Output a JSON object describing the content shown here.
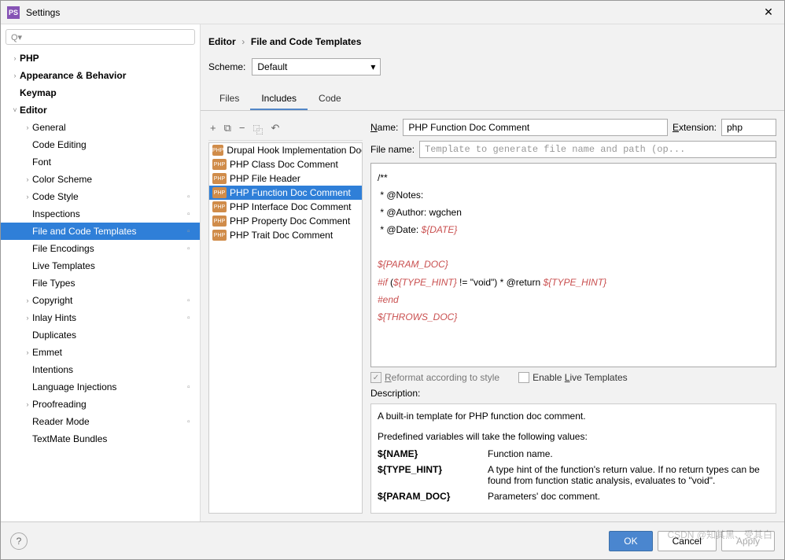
{
  "window": {
    "title": "Settings",
    "close": "✕"
  },
  "search": {
    "placeholder": ""
  },
  "tree": [
    {
      "label": "PHP",
      "bold": true,
      "chev": ">",
      "marker": "",
      "indent": 0
    },
    {
      "label": "Appearance & Behavior",
      "bold": true,
      "chev": ">",
      "marker": "",
      "indent": 0
    },
    {
      "label": "Keymap",
      "bold": true,
      "chev": "",
      "marker": "",
      "indent": 0
    },
    {
      "label": "Editor",
      "bold": true,
      "chev": "v",
      "marker": "",
      "indent": 0
    },
    {
      "label": "General",
      "bold": false,
      "chev": ">",
      "marker": "",
      "indent": 1
    },
    {
      "label": "Code Editing",
      "bold": false,
      "chev": "",
      "marker": "",
      "indent": 1
    },
    {
      "label": "Font",
      "bold": false,
      "chev": "",
      "marker": "",
      "indent": 1
    },
    {
      "label": "Color Scheme",
      "bold": false,
      "chev": ">",
      "marker": "",
      "indent": 1
    },
    {
      "label": "Code Style",
      "bold": false,
      "chev": ">",
      "marker": "■",
      "indent": 1
    },
    {
      "label": "Inspections",
      "bold": false,
      "chev": "",
      "marker": "■",
      "indent": 1
    },
    {
      "label": "File and Code Templates",
      "bold": false,
      "chev": "",
      "marker": "■",
      "indent": 1,
      "selected": true
    },
    {
      "label": "File Encodings",
      "bold": false,
      "chev": "",
      "marker": "■",
      "indent": 1
    },
    {
      "label": "Live Templates",
      "bold": false,
      "chev": "",
      "marker": "",
      "indent": 1
    },
    {
      "label": "File Types",
      "bold": false,
      "chev": "",
      "marker": "",
      "indent": 1
    },
    {
      "label": "Copyright",
      "bold": false,
      "chev": ">",
      "marker": "■",
      "indent": 1
    },
    {
      "label": "Inlay Hints",
      "bold": false,
      "chev": ">",
      "marker": "■",
      "indent": 1
    },
    {
      "label": "Duplicates",
      "bold": false,
      "chev": "",
      "marker": "",
      "indent": 1
    },
    {
      "label": "Emmet",
      "bold": false,
      "chev": ">",
      "marker": "",
      "indent": 1
    },
    {
      "label": "Intentions",
      "bold": false,
      "chev": "",
      "marker": "",
      "indent": 1
    },
    {
      "label": "Language Injections",
      "bold": false,
      "chev": "",
      "marker": "■",
      "indent": 1
    },
    {
      "label": "Proofreading",
      "bold": false,
      "chev": ">",
      "marker": "",
      "indent": 1
    },
    {
      "label": "Reader Mode",
      "bold": false,
      "chev": "",
      "marker": "■",
      "indent": 1
    },
    {
      "label": "TextMate Bundles",
      "bold": false,
      "chev": "",
      "marker": "",
      "indent": 1
    }
  ],
  "breadcrumb": {
    "a": "Editor",
    "sep": "›",
    "b": "File and Code Templates"
  },
  "scheme": {
    "label": "Scheme:",
    "value": "Default"
  },
  "tabs": [
    "Files",
    "Includes",
    "Code"
  ],
  "tabs_active": 1,
  "toolbar": {
    "add": "+",
    "copy_tpl": "⧉",
    "remove": "−",
    "copy": "⿻",
    "revert": "↶"
  },
  "templates": [
    "Drupal Hook Implementation Doc",
    "PHP Class Doc Comment",
    "PHP File Header",
    "PHP Function Doc Comment",
    "PHP Interface Doc Comment",
    "PHP Property Doc Comment",
    "PHP Trait Doc Comment"
  ],
  "templates_selected": 3,
  "fields": {
    "name_label": "Name:",
    "name_ul": "N",
    "name_value": "PHP Function Doc Comment",
    "ext_label": "Extension:",
    "ext_ul": "E",
    "ext_value": "php",
    "fname_label": "File name:",
    "fname_placeholder": "Template to generate file name and path (op..."
  },
  "code": {
    "l1": "/**",
    "l2": " * @Notes:",
    "l3": " * @Author: wgchen",
    "l4a": " * @Date: ",
    "l4b": "${DATE}",
    "blank": " ",
    "l5": "${PARAM_DOC}",
    "l6a": "#if ",
    "l6b": "(",
    "l6c": "${TYPE_HINT}",
    "l6d": " != \"void\") * @return ",
    "l6e": "${TYPE_HINT}",
    "l7": "#end",
    "l8": "${THROWS_DOC}"
  },
  "options": {
    "reformat": "Reformat according to style",
    "reformat_ul": "R",
    "live": "Enable Live Templates",
    "live_ul": "L",
    "check": "✓"
  },
  "desc": {
    "label": "Description:",
    "p1": "A built-in template for PHP function doc comment.",
    "p2": "Predefined variables will take the following values:",
    "v1n": "${NAME}",
    "v1d": "Function name.",
    "v2n": "${TYPE_HINT}",
    "v2d": "A type hint of the function's return value. If no return types can be found from function static analysis, evaluates to \"void\".",
    "v3n": "${PARAM_DOC}",
    "v3d": "Parameters' doc comment."
  },
  "footer": {
    "help": "?",
    "ok": "OK",
    "cancel": "Cancel",
    "apply": "Apply"
  },
  "watermark": "CSDN @知其黑、受其白"
}
